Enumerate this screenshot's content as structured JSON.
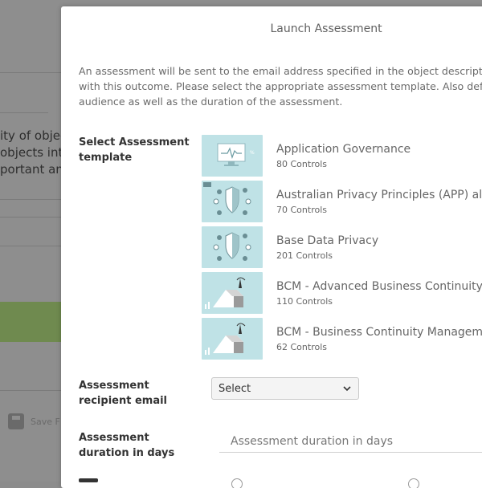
{
  "background": {
    "text_lines": [
      "ity of objec",
      "objects into",
      "portant and"
    ],
    "save_label": "Save F"
  },
  "modal": {
    "title": "Launch Assessment",
    "intro_lines": [
      "An assessment will be sent to the email address specified in the object description",
      "with this outcome. Please select the appropriate assessment template. Also define",
      "audience as well as the duration of the assessment."
    ],
    "select_template_label": "Select Assessment template",
    "templates": [
      {
        "name": "Application Governance",
        "controls": "80 Controls",
        "icon": "monitor-chart-icon"
      },
      {
        "name": "Australian Privacy Principles (APP) alig",
        "controls": "70 Controls",
        "icon": "privacy-shield-icon"
      },
      {
        "name": "Base Data Privacy",
        "controls": "201 Controls",
        "icon": "privacy-shield-icon"
      },
      {
        "name": "BCM - Advanced Business Continuity M",
        "controls": "110 Controls",
        "icon": "bcm-tower-icon"
      },
      {
        "name": "BCM - Business Continuity Manageme",
        "controls": "62 Controls",
        "icon": "bcm-tower-icon"
      }
    ],
    "recipient_label": "Assessment recipient email",
    "recipient_select_value": "Select",
    "duration_label": "Assessment duration in days",
    "duration_placeholder": "Assessment duration in days"
  },
  "colors": {
    "overlay": "#8e8e8e",
    "thumb_bg": "#bfe2e6",
    "green_block": "#6f8a4f"
  }
}
